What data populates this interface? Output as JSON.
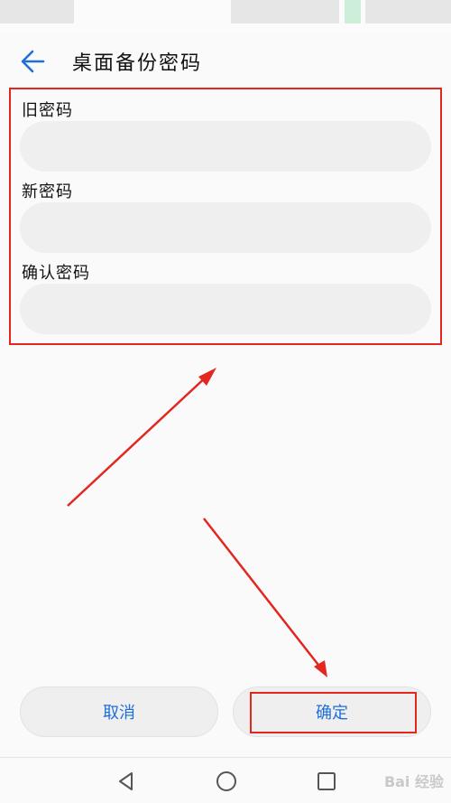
{
  "app_bar": {
    "title": "桌面备份密码"
  },
  "form": {
    "fields": [
      {
        "label": "旧密码",
        "value": "",
        "placeholder": ""
      },
      {
        "label": "新密码",
        "value": "",
        "placeholder": ""
      },
      {
        "label": "确认密码",
        "value": "",
        "placeholder": ""
      }
    ]
  },
  "actions": {
    "cancel_label": "取消",
    "confirm_label": "确定"
  },
  "nav": {
    "back_icon": "triangle-back-icon",
    "home_icon": "circle-home-icon",
    "recents_icon": "square-recents-icon"
  },
  "watermark": {
    "text": "Bai 经验"
  },
  "colors": {
    "accent": "#1e6fd8",
    "annotation": "#e32620",
    "field_background": "#efefef"
  }
}
